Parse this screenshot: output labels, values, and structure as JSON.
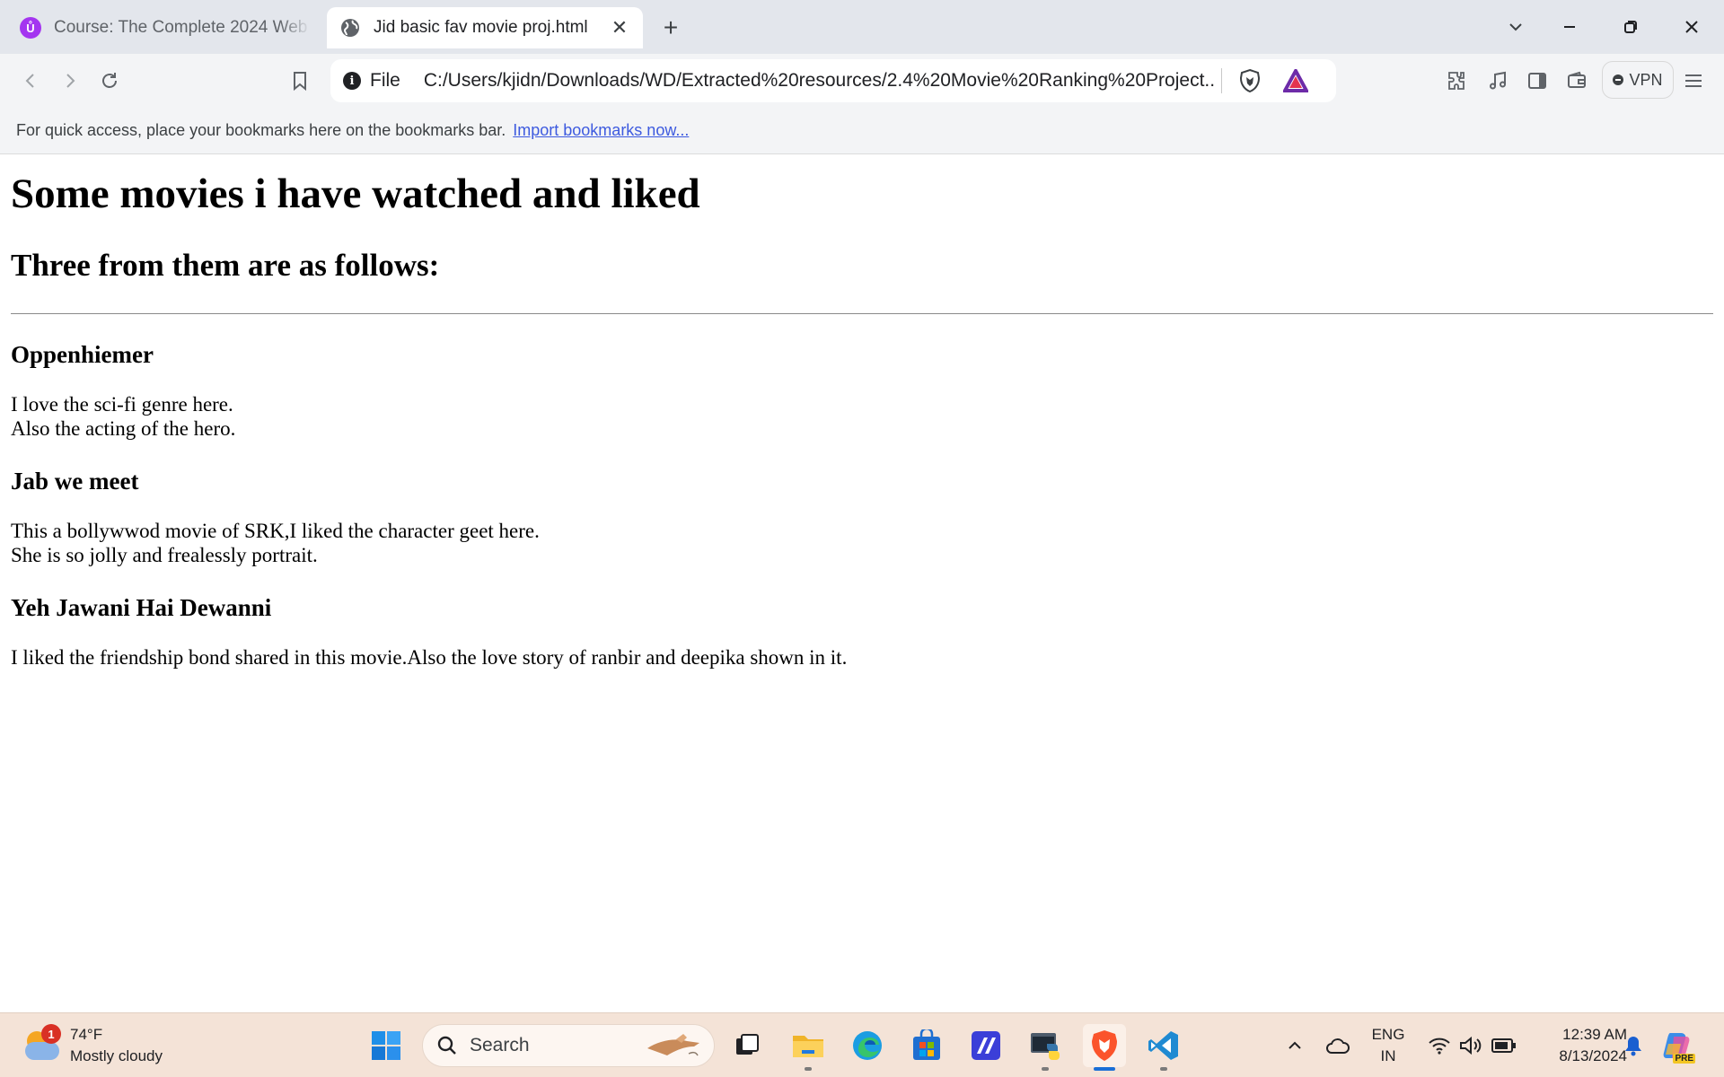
{
  "browser": {
    "tabs": [
      {
        "title": "Course: The Complete 2024 Web De",
        "active": false,
        "favicon": "udemy-icon"
      },
      {
        "title": "Jid basic fav movie proj.html",
        "active": true,
        "favicon": "globe-icon"
      }
    ],
    "address": {
      "scheme_label": "File",
      "url": "C:/Users/kjidn/Downloads/WD/Extracted%20resources/2.4%20Movie%20Ranking%20Project..."
    },
    "vpn_label": "VPN",
    "bookmarks_bar": {
      "message": "For quick access, place your bookmarks here on the bookmarks bar.",
      "link": "Import bookmarks now..."
    },
    "accent_color": "#3d5adf"
  },
  "page": {
    "heading": "Some movies i have watched and liked",
    "subheading": "Three from them are as follows:",
    "movies": [
      {
        "title": "Oppenhiemer",
        "lines": [
          "I love the sci-fi genre here.",
          "Also the acting of the hero."
        ]
      },
      {
        "title": "Jab we meet",
        "lines": [
          "This a bollywwod movie of SRK,I liked the character geet here.",
          "She is so jolly and frealessly portrait."
        ]
      },
      {
        "title": "Yeh Jawani Hai Dewanni",
        "lines": [
          "I liked the friendship bond shared in this movie.Also the love story of ranbir and deepika shown in it."
        ]
      }
    ]
  },
  "taskbar": {
    "weather": {
      "temperature": "74°F",
      "condition": "Mostly cloudy",
      "badge": "1"
    },
    "search_placeholder": "Search",
    "language": {
      "line1": "ENG",
      "line2": "IN"
    },
    "clock": {
      "time": "12:39 AM",
      "date": "8/13/2024"
    },
    "copilot_badge": "PRE"
  }
}
